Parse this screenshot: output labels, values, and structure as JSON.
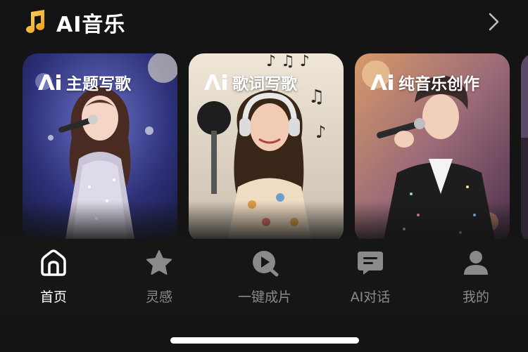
{
  "header": {
    "title": "AI音乐",
    "title_icon": "music-note-icon",
    "more_icon": "chevron-right-icon"
  },
  "cards": [
    {
      "label": "主题写歌",
      "logo": "Ai",
      "image": "singer-girl-sparkly-dress"
    },
    {
      "label": "歌词写歌",
      "logo": "Ai",
      "image": "singer-girl-studio-headphones"
    },
    {
      "label": "纯音乐创作",
      "logo": "Ai",
      "image": "singer-boy-sequin-jacket"
    }
  ],
  "tabs": [
    {
      "label": "首页",
      "icon": "home-icon",
      "active": true
    },
    {
      "label": "灵感",
      "icon": "star-icon",
      "active": false
    },
    {
      "label": "一键成片",
      "icon": "play-search-icon",
      "active": false
    },
    {
      "label": "AI对话",
      "icon": "chat-icon",
      "active": false
    },
    {
      "label": "我的",
      "icon": "person-icon",
      "active": false
    }
  ],
  "colors": {
    "background": "#141414",
    "note_gold": "#f5b82e",
    "tab_active": "#ffffff",
    "tab_inactive": "#8a8a8a"
  }
}
